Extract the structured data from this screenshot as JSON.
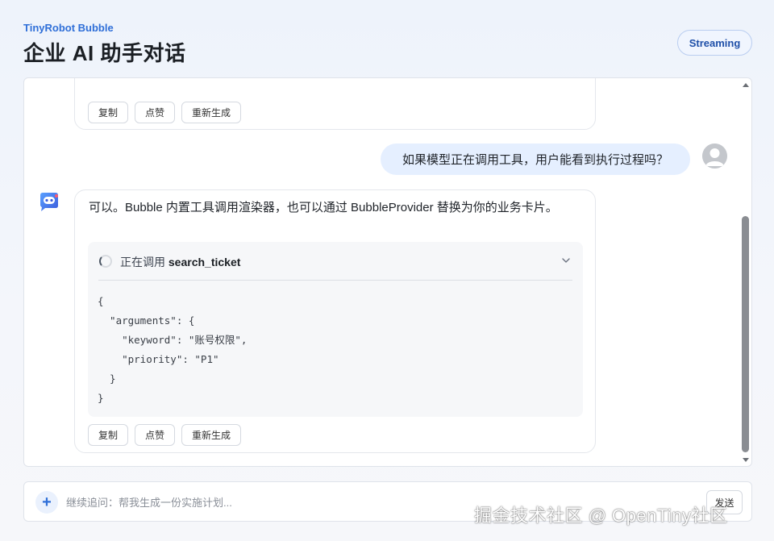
{
  "header": {
    "subtitle": "TinyRobot Bubble",
    "title": "企业 AI 助手对话",
    "badge": "Streaming"
  },
  "top_message": {
    "actions": [
      "复制",
      "点赞",
      "重新生成"
    ]
  },
  "user_message": {
    "text": "如果模型正在调用工具，用户能看到执行过程吗？"
  },
  "bot_message": {
    "text": "可以。Bubble 内置工具调用渲染器，也可以通过 BubbleProvider 替换为你的业务卡片。",
    "tool_call": {
      "status_prefix": "正在调用",
      "tool_name": "search_ticket",
      "code": "{\n  \"arguments\": {\n    \"keyword\": \"账号权限\",\n    \"priority\": \"P1\"\n  }\n}"
    },
    "actions": [
      "复制",
      "点赞",
      "重新生成"
    ]
  },
  "composer": {
    "placeholder": "继续追问：帮我生成一份实施计划...",
    "send_label": "发送",
    "plus_label": "+"
  },
  "watermark": "掘金技术社区 @ OpenTiny社区",
  "colors": {
    "accent": "#2f6fd8",
    "user_bubble": "#e5efff"
  }
}
